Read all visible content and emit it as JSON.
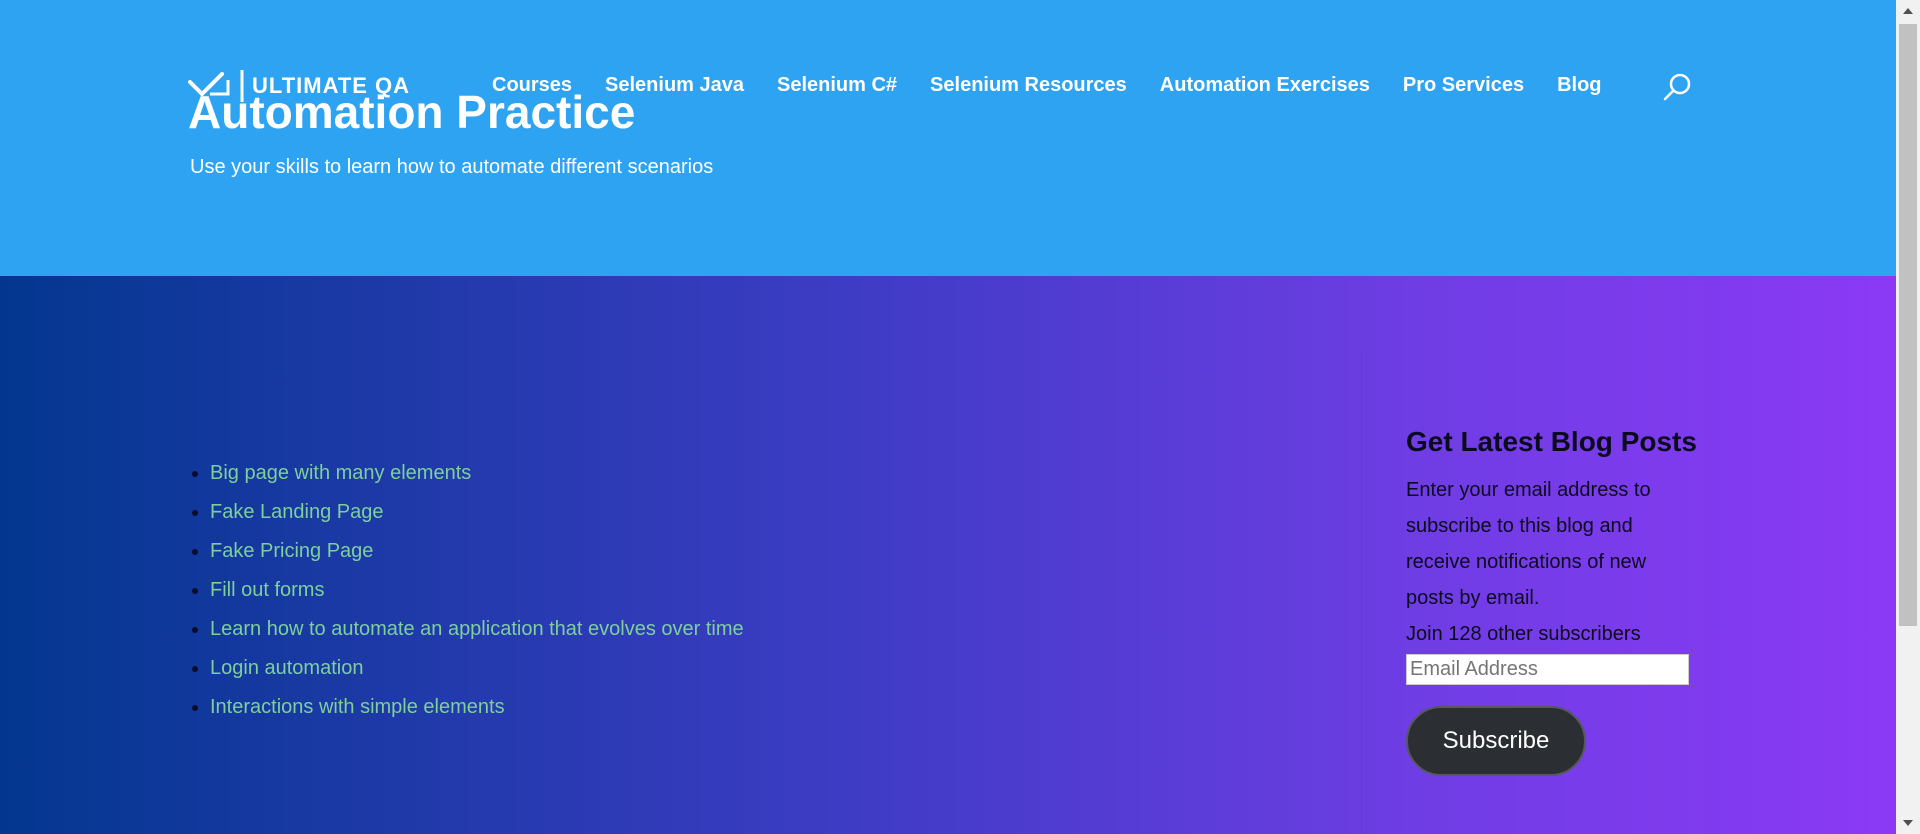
{
  "header": {
    "logo_text": "ULTIMATE QA",
    "nav": [
      "Courses",
      "Selenium Java",
      "Selenium C#",
      "Selenium Resources",
      "Automation Exercises",
      "Pro Services",
      "Blog"
    ],
    "title": "Automation Practice",
    "subtitle": "Use your skills to learn how to automate different scenarios"
  },
  "main": {
    "links": [
      "Big page with many elements",
      "Fake Landing Page",
      "Fake Pricing Page",
      "Fill out forms",
      "Learn how to automate an application that evolves over time",
      "Login automation",
      "Interactions with simple elements"
    ]
  },
  "widget": {
    "title": "Get Latest Blog Posts",
    "description": "Enter your email address to subscribe to this blog and receive notifications of new posts by email.",
    "join_text": "Join 128 other subscribers",
    "email_placeholder": "Email Address",
    "subscribe_label": "Subscribe"
  },
  "colors": {
    "header_bg": "#2ea3f2",
    "gradient_start": "#03378f",
    "gradient_end": "#8b39f5",
    "link_color": "#7ecf9c",
    "button_bg": "#2b2e33"
  },
  "icons": {
    "logo": "checkmark-logo-icon",
    "search": "search-icon"
  }
}
